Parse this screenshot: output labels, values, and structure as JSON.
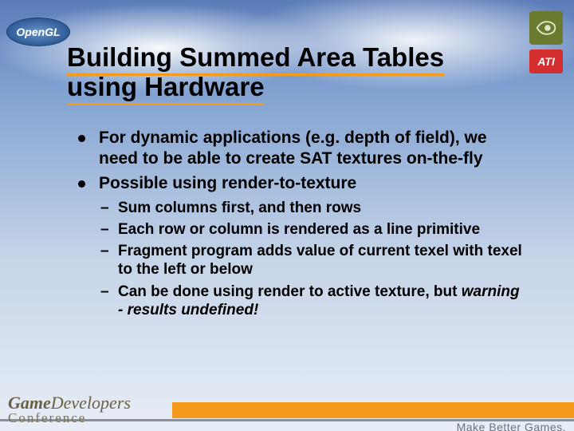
{
  "logos": {
    "opengl_text": "OpenGL",
    "ati_text": "ATI"
  },
  "title": "Building Summed Area Tables using Hardware",
  "bullets": [
    {
      "text": "For dynamic applications (e.g. depth of field), we need to be able to create SAT textures on-the-fly"
    },
    {
      "text": "Possible using render-to-texture",
      "sub": [
        "Sum columns first, and then rows",
        "Each row or column is rendered as a line primitive",
        "Fragment program adds value of current texel with texel to the left or below",
        "Can be done using render to active texture, but "
      ]
    }
  ],
  "warning_italic": "warning - results undefined!",
  "footer": {
    "gdc_game": "Game",
    "gdc_dev": "Developers",
    "gdc_conf": "Conference",
    "tagline": "Make Better Games."
  }
}
